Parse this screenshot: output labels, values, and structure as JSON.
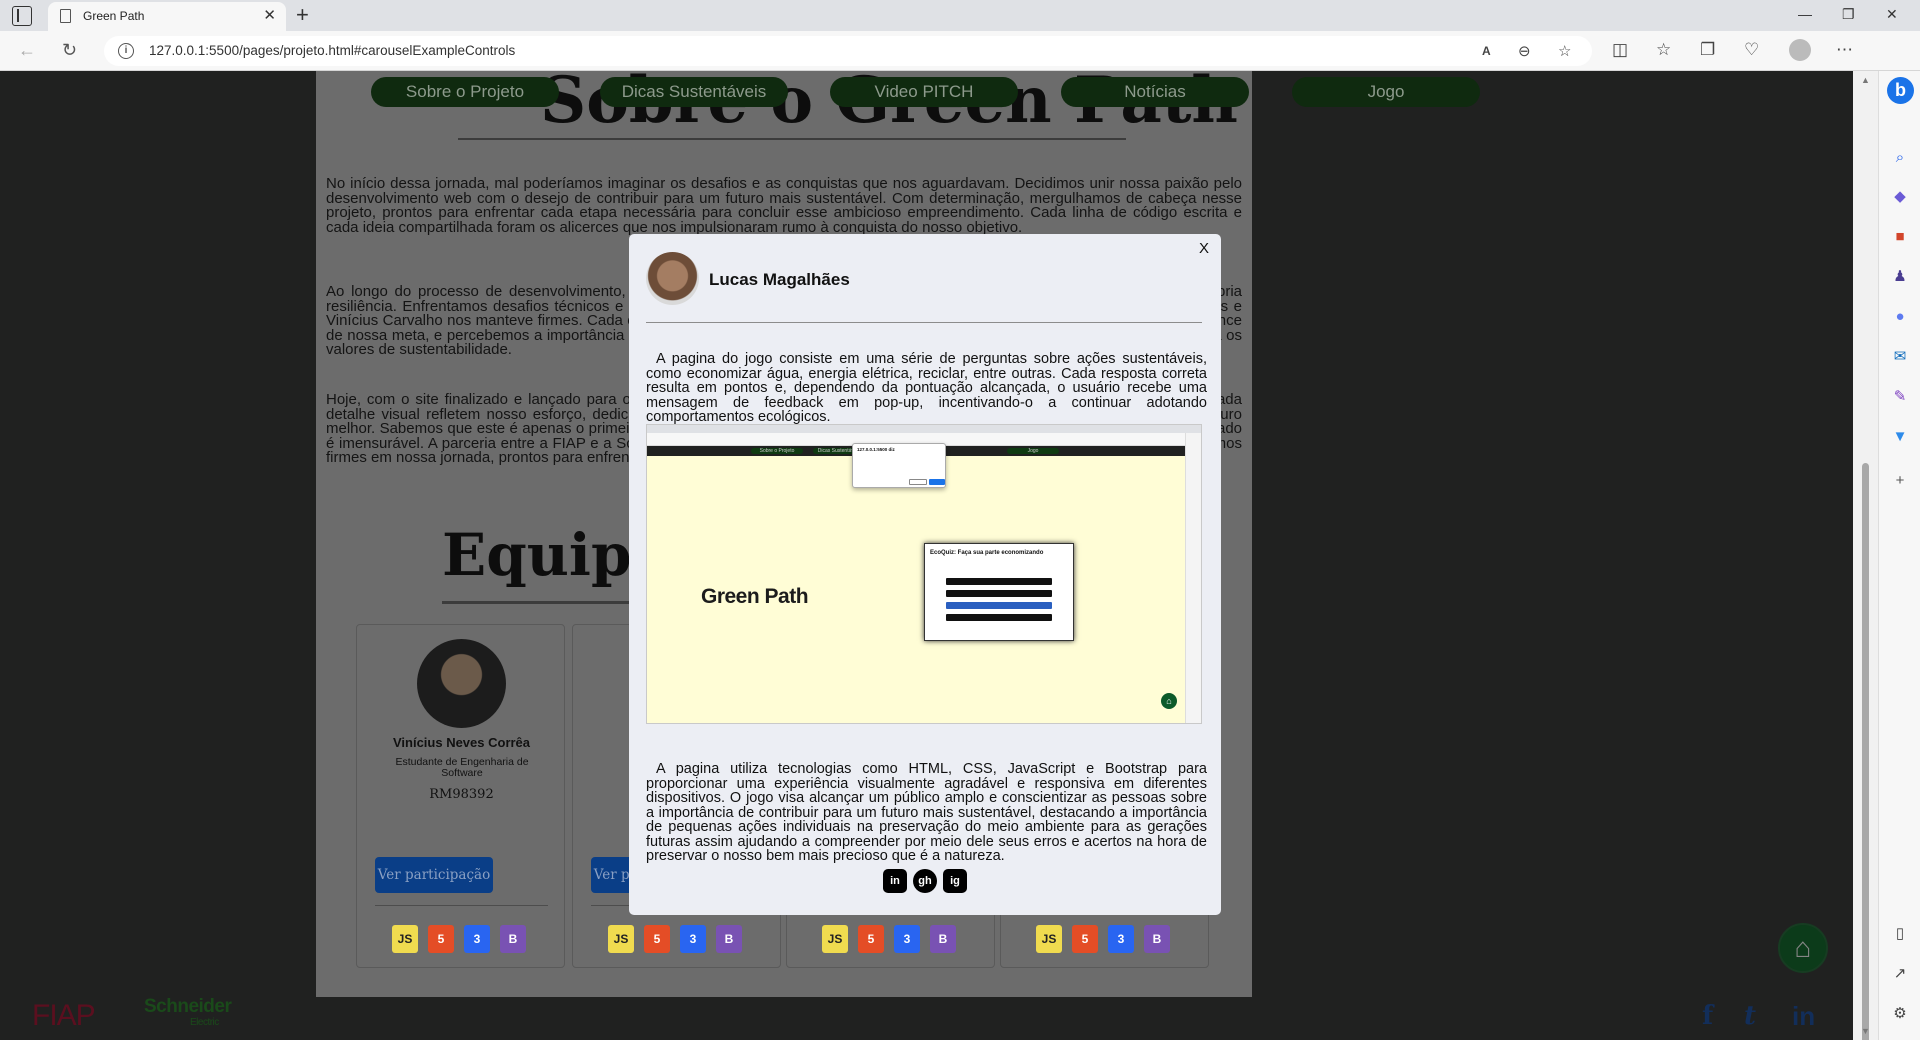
{
  "browser": {
    "tab_title": "Green Path",
    "tab_close": "✕",
    "new_tab": "+",
    "url": "127.0.0.1:5500/pages/projeto.html#carouselExampleControls",
    "info_glyph": "i",
    "minimize": "—",
    "restore": "❐",
    "close": "✕",
    "bing_glyph": "b"
  },
  "nav": {
    "items": [
      "Sobre o Projeto",
      "Dicas Sustentáveis",
      "Video PITCH",
      "Notícias",
      "Jogo"
    ]
  },
  "page": {
    "title": "Sobre o Green Path",
    "paragraphs": [
      "No início dessa jornada, mal poderíamos imaginar os desafios e as conquistas que nos aguardavam. Decidimos unir nossa paixão pelo desenvolvimento web com o desejo de contribuir para um futuro mais sustentável. Com determinação, mergulhamos de cabeça nesse projeto, prontos para enfrentar cada etapa necessária para concluir esse ambicioso empreendimento. Cada linha de código escrita e cada ideia compartilhada foram os alicerces que nos impulsionaram rumo à conquista do nosso objetivo.",
      "Ao longo do processo de desenvolvimento, aprendemos muito sobre tecnologia, sobre trabalho em equipe e sobre a nossa própria resiliência. Enfrentamos desafios técnicos e criativos, mas a união do grupo formado por Davi Domingues, Murilo, Lucas Magalhães e Vinícius Carvalho nos manteve firmes. Cada obstáculo superado e cada funcionalidade finalizada nos aproximava ainda mais do alcance de nossa meta, e percebemos a importância tanto do domínio técnico da programação quanto à relevância de colocarmos em prática os valores de sustentabilidade.",
      "Hoje, com o site finalizado e lançado para o mundo, sentimos um imenso orgulho do trabalho realizado. Cada linhade código e cada detalhe visual refletem nosso esforço, dedicação e compromisso com a causa, além do desejo genuíno de contribuir para um futuro melhor. Sabemos que este é apenas o primeiro passo de um longo caminho, mas a sensação de conquista e aprendizado compartilhado é imensurável. A parceria entre a FIAP e a Schneider nos impulsiona a ir além, tornando realidade a criação do Green Path, e seguimos firmes em nossa jornada, prontos para enfrentar os próximos desafios."
    ],
    "team_title": "Equipe",
    "see_button": "Ver participação",
    "cards": [
      {
        "name": "Vinícius Neves Corrêa",
        "role": "Estudante de Engenharia de Software",
        "rm": "RM98392"
      }
    ],
    "tech_icons": [
      "JS",
      "5",
      "3",
      "B"
    ],
    "tech_colors": {
      "js": "#f0db4f",
      "html": "#e44d26",
      "css": "#2965f1",
      "bs": "#7952b3"
    },
    "fiap": "FIAP",
    "schneider": [
      "Schneider",
      "Electric"
    ],
    "social": [
      "f",
      "t",
      "in"
    ]
  },
  "modal": {
    "close": "X",
    "name": "Lucas Magalhães",
    "text1": "A pagina do jogo consiste em uma série de perguntas sobre ações sustentáveis, como economizar água, energia elétrica, reciclar, entre outras. Cada resposta correta resulta em pontos e, dependendo da pontuação alcançada, o usuário recebe uma mensagem de feedback em pop-up, incentivando-o a continuar adotando comportamentos ecológicos.",
    "text2": "A pagina utiliza tecnologias como HTML, CSS, JavaScript e Bootstrap para proporcionar uma experiência visualmente agradável e responsiva em diferentes dispositivos. O jogo visa alcançar um público amplo e conscientizar as pessoas sobre a importância de contribuir para um futuro mais sustentável, destacando a importância de pequenas ações individuais na preservação do meio ambiente para as gerações futuras assim ajudando a compreender por meio dele seus erros e acertos na hora de preservar o nosso bem mais precioso que é a natureza.",
    "screenshot": {
      "logo": "Green Path",
      "alert_title": "127.0.0.1:5500 diz",
      "quiz_title": "EcoQuiz: Faça sua parte economizando",
      "nav": [
        "Sobre o Projeto",
        "Dicas Sustentáveis",
        "Jogo"
      ]
    },
    "icons": [
      "in",
      "gh",
      "ig"
    ]
  }
}
